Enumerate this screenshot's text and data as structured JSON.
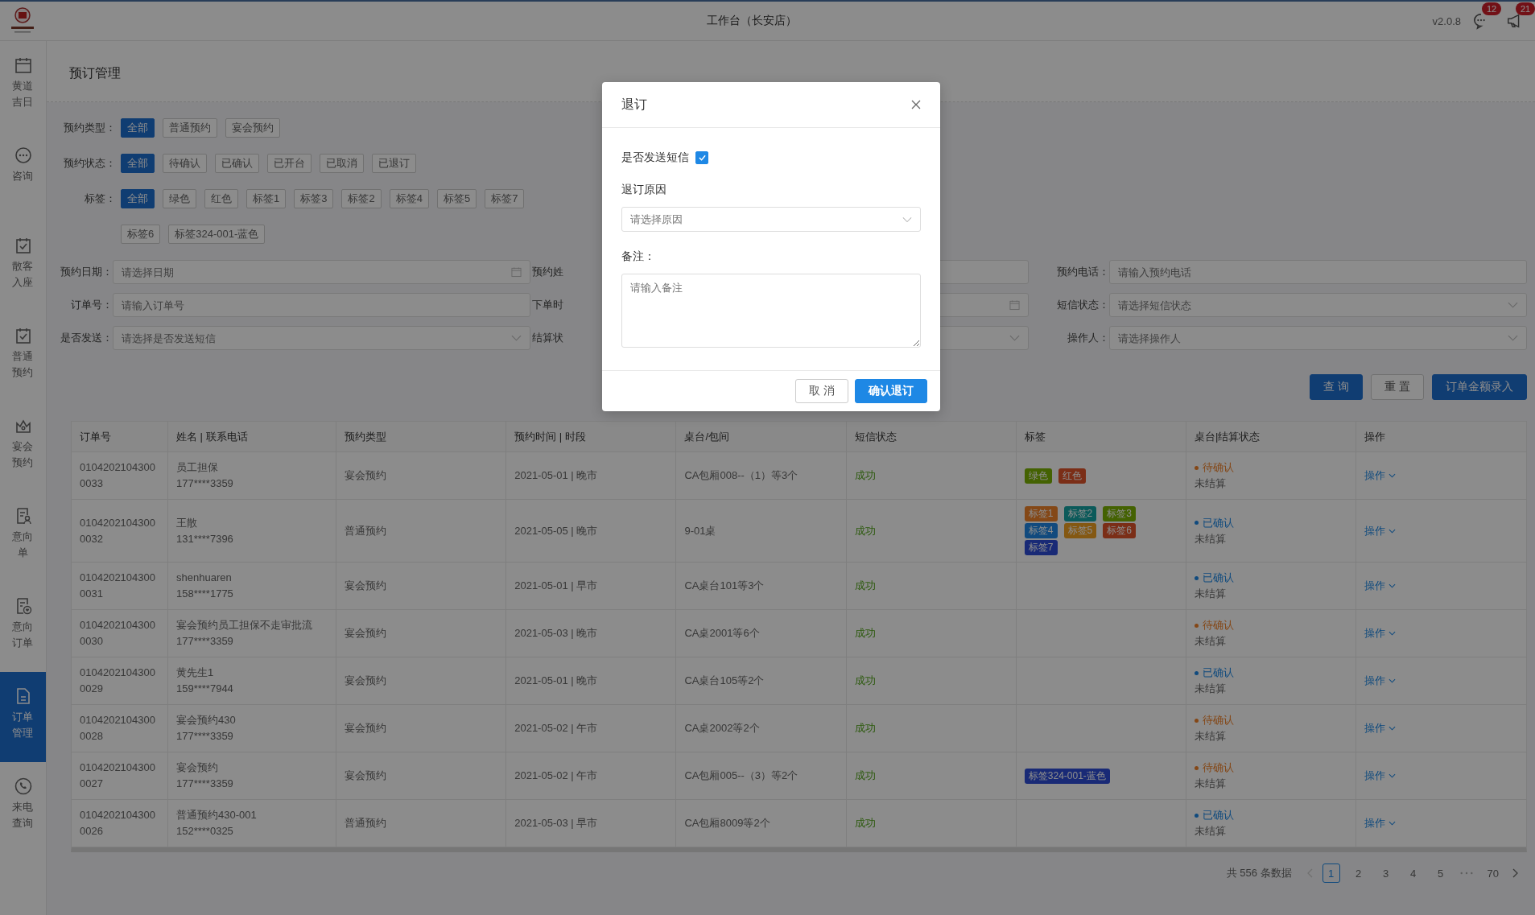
{
  "header": {
    "title": "工作台（长安店）",
    "version": "v2.0.8",
    "messages_badge": "12",
    "notices_badge": "21"
  },
  "sidebar": {
    "items": [
      {
        "label": "黄道吉日",
        "kind": "calendar",
        "selected": false
      },
      {
        "label": "咨询",
        "kind": "chat",
        "selected": false
      },
      {
        "label": "散客入座",
        "kind": "calendar-check",
        "selected": false
      },
      {
        "label": "普通预约",
        "kind": "calendar-check",
        "selected": false
      },
      {
        "label": "宴会预约",
        "kind": "crown",
        "selected": false
      },
      {
        "label": "意向单",
        "kind": "doc-person",
        "selected": false
      },
      {
        "label": "意向订单",
        "kind": "doc-heart",
        "selected": false
      },
      {
        "label": "订单管理",
        "kind": "doc",
        "selected": true
      },
      {
        "label": "来电查询",
        "kind": "phone",
        "selected": false
      }
    ]
  },
  "page": {
    "title": "预订管理"
  },
  "filter_groups": [
    {
      "label": "预约类型：",
      "chips": [
        {
          "label": "全部",
          "selected": true
        },
        {
          "label": "普通预约",
          "selected": false
        },
        {
          "label": "宴会预约",
          "selected": false
        }
      ]
    },
    {
      "label": "预约状态：",
      "chips": [
        {
          "label": "全部",
          "selected": true
        },
        {
          "label": "待确认",
          "selected": false
        },
        {
          "label": "已确认",
          "selected": false
        },
        {
          "label": "已开台",
          "selected": false
        },
        {
          "label": "已取消",
          "selected": false
        },
        {
          "label": "已退订",
          "selected": false
        }
      ]
    },
    {
      "label": "标签：",
      "chips": [
        {
          "label": "全部",
          "selected": true
        },
        {
          "label": "绿色",
          "selected": false
        },
        {
          "label": "红色",
          "selected": false
        },
        {
          "label": "标签1",
          "selected": false
        },
        {
          "label": "标签3",
          "selected": false
        },
        {
          "label": "标签2",
          "selected": false
        },
        {
          "label": "标签4",
          "selected": false
        },
        {
          "label": "标签5",
          "selected": false
        },
        {
          "label": "标签7",
          "selected": false
        },
        {
          "label": "标签6",
          "selected": false
        },
        {
          "label": "标签324-001-蓝色",
          "selected": false
        }
      ]
    }
  ],
  "fields": [
    {
      "label": "预约日期：",
      "placeholder": "请选择日期",
      "kind": "date"
    },
    {
      "label": "预约姓",
      "kind": "text"
    },
    {
      "label": "预约电话：",
      "placeholder": "请输入预约电话",
      "kind": "text"
    },
    {
      "label": "订单号：",
      "placeholder": "请输入订单号",
      "kind": "text"
    },
    {
      "label": "下单时",
      "kind": "date"
    },
    {
      "label": "短信状态：",
      "placeholder": "请选择短信状态",
      "kind": "select"
    },
    {
      "label": "是否发送：",
      "placeholder": "请选择是否发送短信",
      "kind": "select"
    },
    {
      "label": "结算状",
      "kind": "select"
    },
    {
      "label": "操作人：",
      "placeholder": "请选择操作人",
      "kind": "select"
    }
  ],
  "actions": [
    {
      "label": "查 询",
      "kind": "primary"
    },
    {
      "label": "重 置",
      "kind": "default"
    },
    {
      "label": "订单金额录入",
      "kind": "primary"
    }
  ],
  "table": {
    "columns": [
      "订单号",
      "姓名 | 联系电话",
      "预约类型",
      "预约时间 | 时段",
      "桌台/包间",
      "短信状态",
      "标签",
      "桌台|结算状态",
      "操作"
    ],
    "rows": [
      {
        "order_no": "01042021043000033",
        "name": "员工担保",
        "phone": "177****3359",
        "type": "宴会预约",
        "time": "2021-05-01 | 晚市",
        "table": "CA包厢008--（1）等3个",
        "sms": "成功",
        "tags": [
          {
            "label": "绿色",
            "color": "#446203"
          },
          {
            "label": "红色",
            "color": "#7b2e17"
          }
        ],
        "status": {
          "label": "待确认",
          "kind": "pending"
        },
        "settlement": "未结算",
        "action": "操作"
      },
      {
        "order_no": "01042021043000032",
        "name": "王散",
        "phone": "131****7396",
        "type": "普通预约",
        "time": "2021-05-05 | 晚市",
        "table": "9-01桌",
        "sms": "成功",
        "tags": [
          {
            "label": "标签1",
            "color": "#844817"
          },
          {
            "label": "标签2",
            "color": "#0c5b5b"
          },
          {
            "label": "标签3",
            "color": "#446203"
          },
          {
            "label": "标签4",
            "color": "#114b7e"
          },
          {
            "label": "标签5",
            "color": "#845812"
          },
          {
            "label": "标签6",
            "color": "#7b2e17"
          },
          {
            "label": "标签7",
            "color": "#1a2b76"
          }
        ],
        "status": {
          "label": "已确认",
          "kind": "confirmed"
        },
        "settlement": "未结算",
        "action": "操作"
      },
      {
        "order_no": "01042021043000031",
        "name": "shenhuaren",
        "phone": "158****1775",
        "type": "宴会预约",
        "time": "2021-05-01 | 早市",
        "table": "CA桌台101等3个",
        "sms": "成功",
        "tags": [],
        "status": {
          "label": "已确认",
          "kind": "confirmed"
        },
        "settlement": "未结算",
        "action": "操作"
      },
      {
        "order_no": "01042021043000030",
        "name": "宴会预约员工担保不走审批流",
        "phone": "177****3359",
        "type": "宴会预约",
        "time": "2021-05-03 | 晚市",
        "table": "CA桌2001等6个",
        "sms": "成功",
        "tags": [],
        "status": {
          "label": "待确认",
          "kind": "pending"
        },
        "settlement": "未结算",
        "action": "操作"
      },
      {
        "order_no": "01042021043000029",
        "name": "黄先生1",
        "phone": "159****7944",
        "type": "宴会预约",
        "time": "2021-05-01 | 晚市",
        "table": "CA桌台105等2个",
        "sms": "成功",
        "tags": [],
        "status": {
          "label": "已确认",
          "kind": "confirmed"
        },
        "settlement": "未结算",
        "action": "操作"
      },
      {
        "order_no": "01042021043000028",
        "name": "宴会预约430",
        "phone": "177****3359",
        "type": "宴会预约",
        "time": "2021-05-02 | 午市",
        "table": "CA桌2002等2个",
        "sms": "成功",
        "tags": [],
        "status": {
          "label": "待确认",
          "kind": "pending"
        },
        "settlement": "未结算",
        "action": "操作"
      },
      {
        "order_no": "01042021043000027",
        "name": "宴会预约",
        "phone": "177****3359",
        "type": "宴会预约",
        "time": "2021-05-02 | 午市",
        "table": "CA包厢005--（3）等2个",
        "sms": "成功",
        "tags": [
          {
            "label": "标签324-001-蓝色",
            "color": "#1a2b76"
          }
        ],
        "status": {
          "label": "待确认",
          "kind": "pending"
        },
        "settlement": "未结算",
        "action": "操作"
      },
      {
        "order_no": "01042021043000026",
        "name": "普通预约430-001",
        "phone": "152****0325",
        "type": "普通预约",
        "time": "2021-05-03 | 早市",
        "table": "CA包厢8009等2个",
        "sms": "成功",
        "tags": [],
        "status": {
          "label": "已确认",
          "kind": "confirmed"
        },
        "settlement": "未结算",
        "action": "操作"
      }
    ]
  },
  "pagination": {
    "total": "共 556 条数据",
    "pages": [
      {
        "label": "1",
        "selected": true
      },
      {
        "label": "2",
        "selected": false
      },
      {
        "label": "3",
        "selected": false
      },
      {
        "label": "4",
        "selected": false
      },
      {
        "label": "5",
        "selected": false
      }
    ],
    "last_page": {
      "label": "70",
      "selected": false
    }
  },
  "modal": {
    "title": "退订",
    "sms": {
      "label": "是否发送短信",
      "checked": true
    },
    "reason": {
      "label": "退订原因",
      "placeholder": "请选择原因"
    },
    "note": {
      "label": "备注：",
      "placeholder": "请输入备注"
    },
    "buttons": [
      {
        "label": "取 消",
        "kind": "default"
      },
      {
        "label": "确认退订",
        "kind": "primary"
      }
    ]
  }
}
